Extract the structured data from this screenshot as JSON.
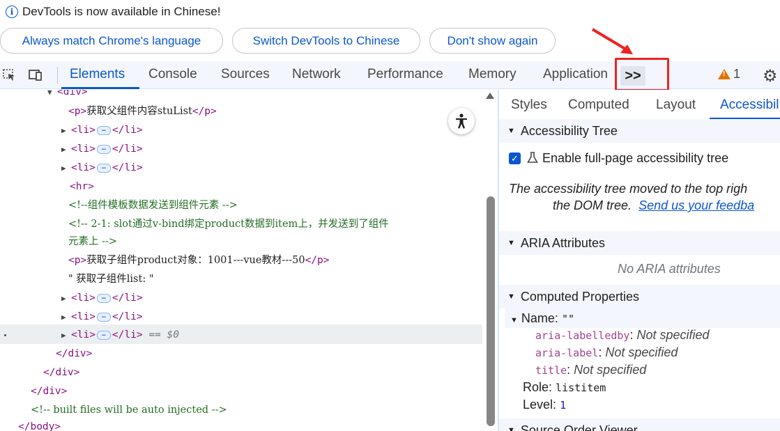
{
  "banner": {
    "message": "DevTools is now available in Chinese!",
    "buttons": [
      "Always match Chrome's language",
      "Switch DevTools to Chinese",
      "Don't show again"
    ]
  },
  "toolbar": {
    "tabs": [
      "Elements",
      "Console",
      "Sources",
      "Network",
      "Performance",
      "Memory",
      "Application"
    ],
    "active_tab": "Elements",
    "more_tabs": ">>",
    "warning_count": "1"
  },
  "dom_tree": {
    "lines": [
      {
        "kind": "tag",
        "text": "<div>"
      },
      {
        "kind": "mixed",
        "open": "<p>",
        "text": "获取父组件内容stuList",
        "close": "</p>"
      },
      {
        "kind": "li",
        "open": "<li>",
        "close": "</li>"
      },
      {
        "kind": "li",
        "open": "<li>",
        "close": "</li>"
      },
      {
        "kind": "li",
        "open": "<li>",
        "close": "</li>"
      },
      {
        "kind": "tag",
        "text": "<hr>"
      },
      {
        "kind": "comment",
        "text": "<!--组件模板数据发送到组件元素 -->"
      },
      {
        "kind": "comment",
        "text": "<!-- 2-1: slot通过v-bind绑定product数据到item上，并发送到了组件"
      },
      {
        "kind": "comment",
        "text": "元素上 -->"
      },
      {
        "kind": "mixed",
        "open": "<p>",
        "text": "获取子组件product对象：1001---vue教材---50",
        "close": "</p>"
      },
      {
        "kind": "text",
        "text": "\" 获取子组件list: \""
      },
      {
        "kind": "li",
        "open": "<li>",
        "close": "</li>"
      },
      {
        "kind": "li",
        "open": "<li>",
        "close": "</li>"
      },
      {
        "kind": "li",
        "open": "<li>",
        "close": "</li>",
        "suffix": "== $0"
      },
      {
        "kind": "tag",
        "text": "</div>"
      },
      {
        "kind": "tag",
        "text": "</div>"
      },
      {
        "kind": "tag",
        "text": "</div>"
      },
      {
        "kind": "comment",
        "text": "<!-- built files will be auto injected -->"
      },
      {
        "kind": "tag",
        "text": "</body>"
      }
    ],
    "ellipsis": "…"
  },
  "sidebar": {
    "tabs": [
      "Styles",
      "Computed",
      "Layout",
      "Accessibil"
    ],
    "active_tab": "Accessibil",
    "accessibility_tree": {
      "heading": "Accessibility Tree",
      "enable_label": "Enable full-page accessibility tree",
      "moved_text_1": "The accessibility tree moved to the top righ",
      "moved_text_2": "the DOM tree.",
      "feedback_link": "Send us your feedba"
    },
    "aria": {
      "heading": "ARIA Attributes",
      "empty": "No ARIA attributes"
    },
    "computed": {
      "heading": "Computed Properties",
      "name_label": "Name:",
      "name_value": "\"\"",
      "props": [
        {
          "name": "aria-labelledby",
          "value": "Not specified"
        },
        {
          "name": "aria-label",
          "value": "Not specified"
        },
        {
          "name": "title",
          "value": "Not specified"
        }
      ],
      "role_label": "Role:",
      "role_value": "listitem",
      "level_label": "Level:",
      "level_value": "1"
    },
    "source_order": {
      "heading": "Source Order Viewer"
    }
  },
  "colors": {
    "accent": "#0b57d0",
    "annotation_red": "#ee2222",
    "tag": "#881280",
    "comment": "#236e25"
  }
}
